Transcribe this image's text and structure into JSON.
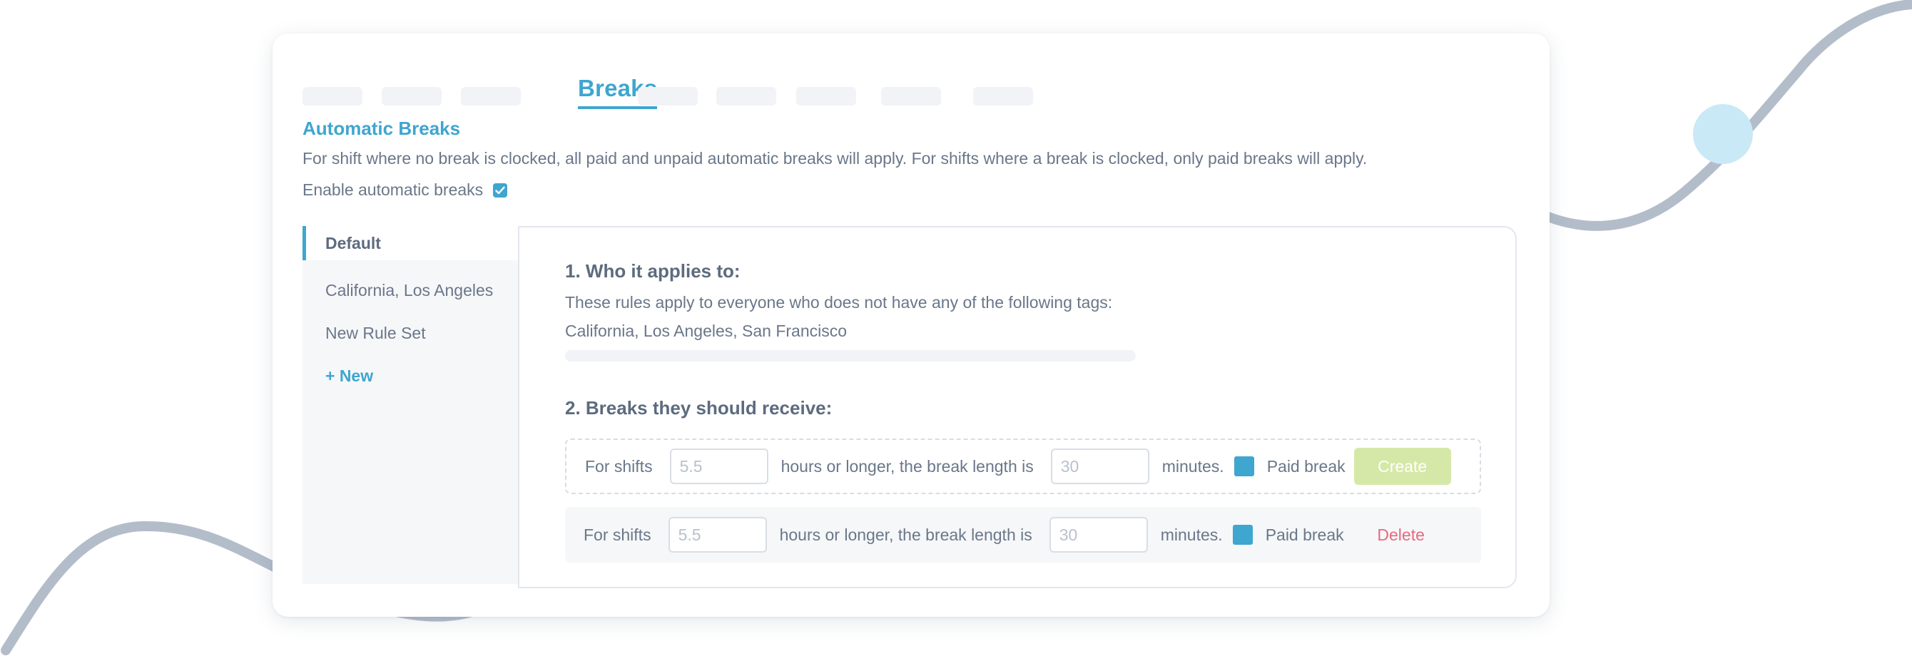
{
  "tabs": {
    "active_label": "Breaks"
  },
  "automatic_breaks": {
    "title": "Automatic Breaks",
    "description": "For shift where no break is clocked, all paid and unpaid automatic breaks will apply. For shifts where a break is clocked, only paid breaks will apply.",
    "enable_label": "Enable automatic breaks",
    "enabled": true
  },
  "rule_sets": {
    "items": [
      {
        "label": "Default"
      },
      {
        "label": "California, Los Angeles"
      },
      {
        "label": "New Rule Set"
      }
    ],
    "new_label": "+ New"
  },
  "rules": {
    "who_title": "1. Who it applies to:",
    "who_desc": "These rules apply to everyone who does not have any of the following tags:",
    "who_tags": "California, Los Angeles, San Francisco",
    "breaks_title": "2. Breaks they should receive:",
    "row_prefix": "For shifts",
    "row_middle": "hours or longer, the break length is",
    "row_suffix": "minutes.",
    "paid_label": "Paid break",
    "hours_placeholder": "5.5",
    "minutes_placeholder": "30",
    "create_label": "Create",
    "delete_label": "Delete"
  },
  "colors": {
    "accent": "#3ea6cf",
    "create_button": "#d6e8a8",
    "delete_text": "#e56b7e",
    "decor_line": "#b3bdca",
    "decor_dot": "#c9e9f6"
  }
}
